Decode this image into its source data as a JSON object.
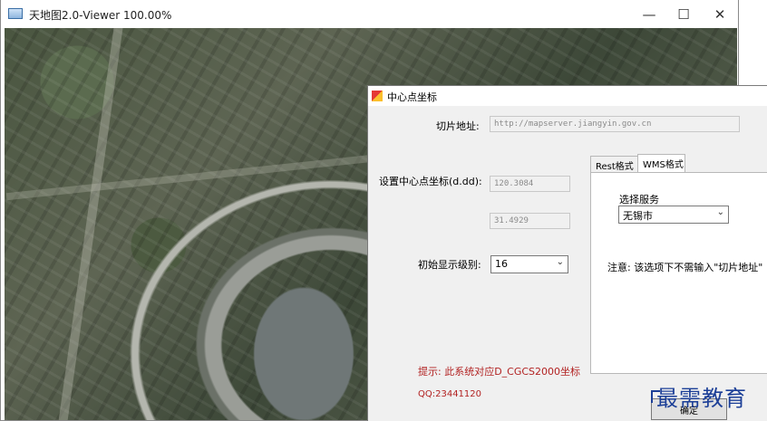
{
  "window": {
    "title": "天地图2.0-Viewer  100.00%",
    "minimize": "—",
    "maximize": "☐",
    "close": "✕"
  },
  "dialog": {
    "title": "中心点坐标",
    "tile_label": "切片地址:",
    "tile_url": "http://mapserver.jiangyin.gov.cn",
    "center_label": "设置中心点坐标(d.dd):",
    "lon": "120.3084",
    "lat": "31.4929",
    "zoom_label": "初始显示级别:",
    "zoom_value": "16",
    "tabs": [
      "Rest格式",
      "WMS格式"
    ],
    "active_tab": 1,
    "service_label": "选择服务",
    "service_value": "无锡市",
    "note": "注意: 该选项下不需输入\"切片地址\"",
    "hint": "提示: 此系统对应D_CGCS2000坐标",
    "qq": "QQ:23441120",
    "ok_label": "确定"
  },
  "watermark": "最需教育",
  "icons": {
    "app": "app-window-icon",
    "dialog": "dialog-icon",
    "dropdown": "chevron-down-icon"
  }
}
